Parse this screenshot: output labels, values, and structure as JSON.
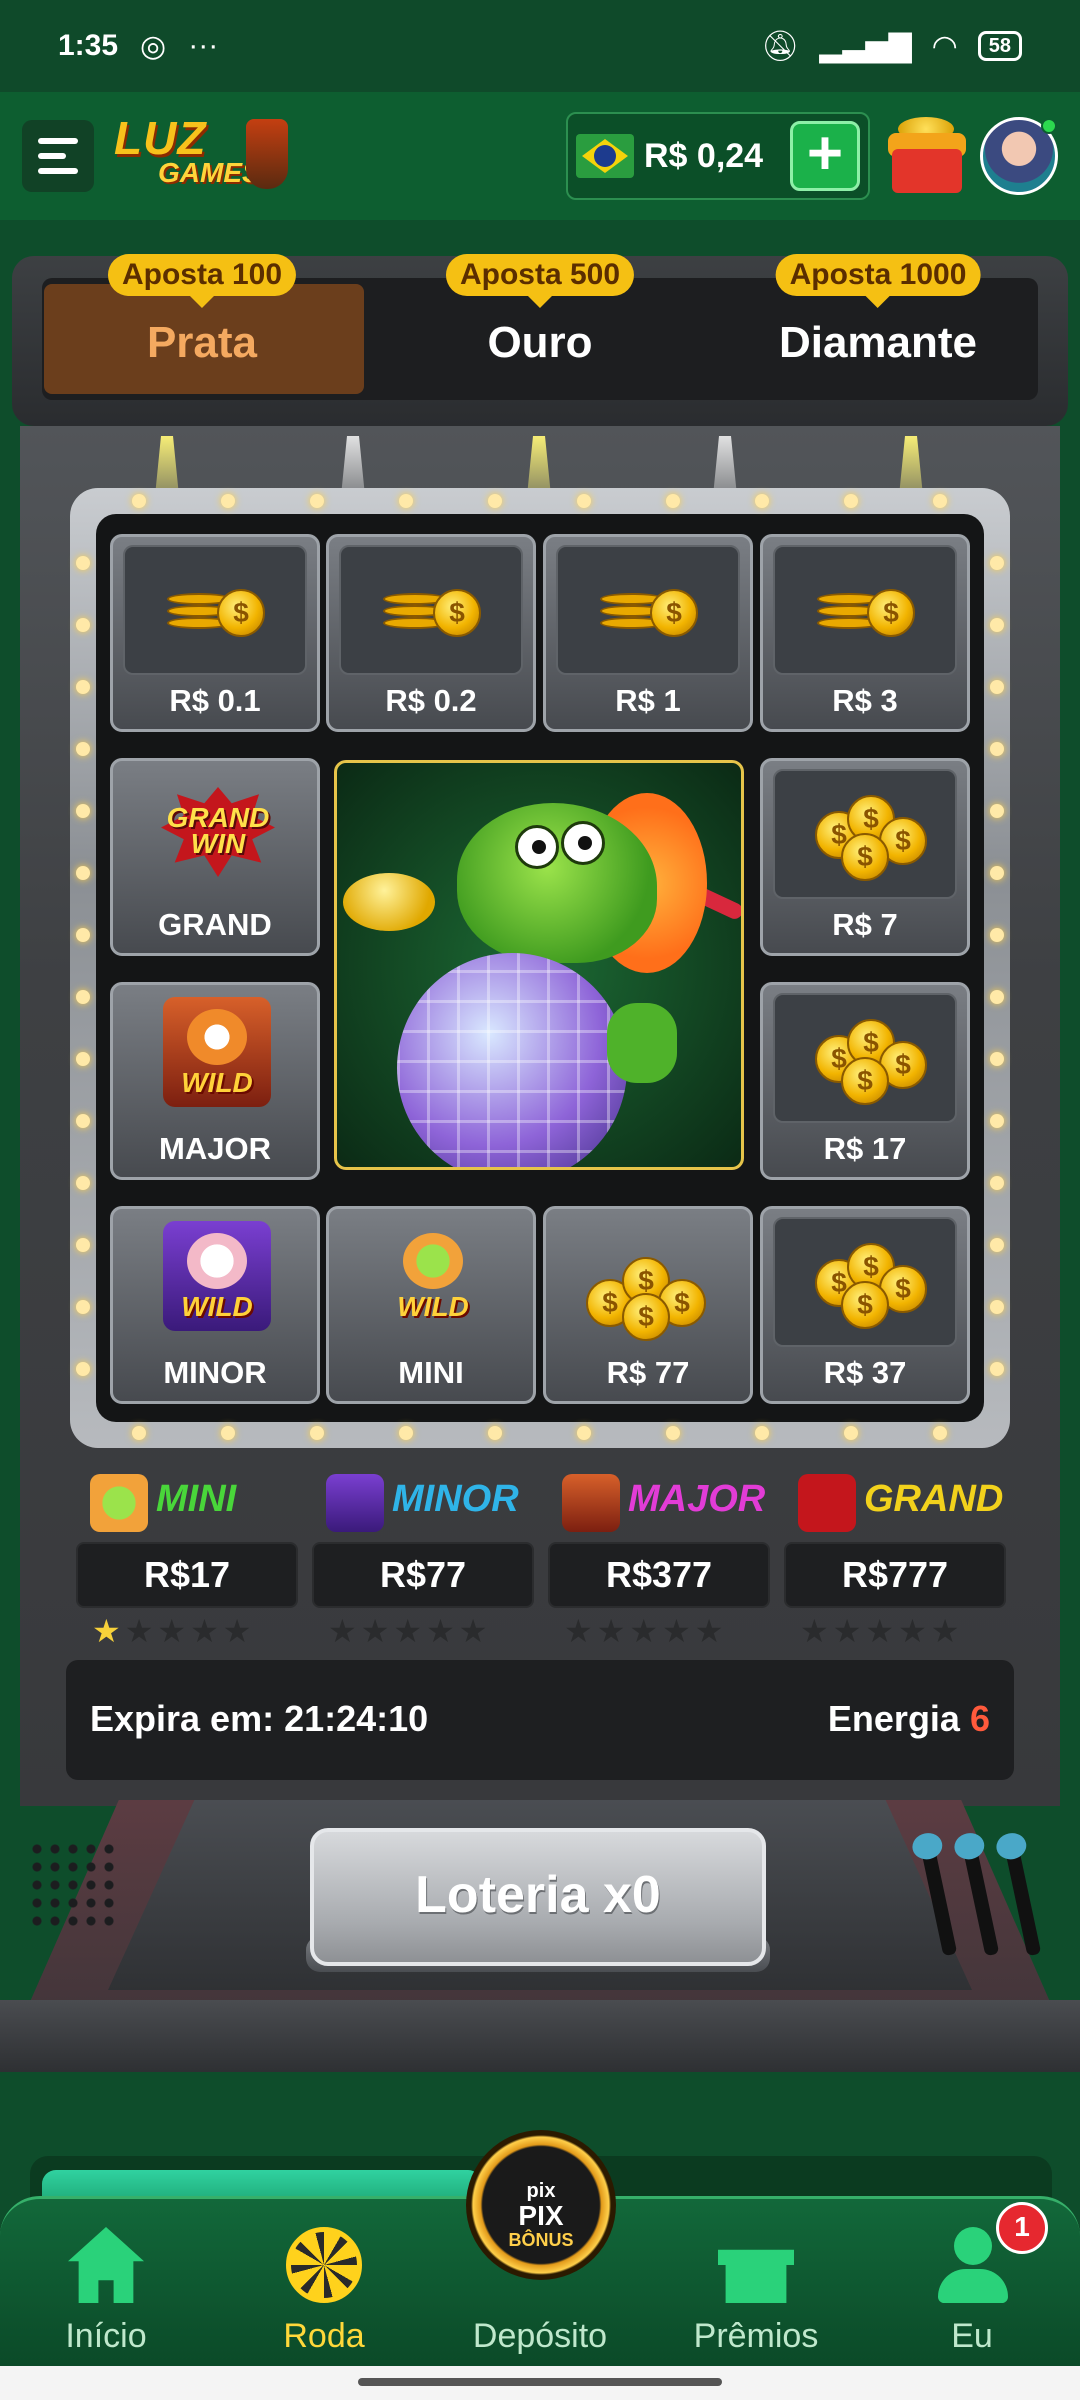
{
  "status_bar": {
    "time": "1:35",
    "battery": "58"
  },
  "header": {
    "logo_text_1": "LUZ",
    "logo_text_2": "GAMES",
    "balance": "R$ 0,24",
    "plus_label": "+"
  },
  "tabs": [
    {
      "badge": "Aposta 100",
      "label": "Prata",
      "active": true
    },
    {
      "badge": "Aposta 500",
      "label": "Ouro",
      "active": false
    },
    {
      "badge": "Aposta 1000",
      "label": "Diamante",
      "active": false
    }
  ],
  "grid": {
    "row1": [
      "R$ 0.1",
      "R$ 0.2",
      "R$ 1",
      "R$ 3"
    ],
    "left": [
      "GRAND",
      "MAJOR"
    ],
    "right": [
      "R$ 7",
      "R$ 17"
    ],
    "row4": [
      "MINOR",
      "MINI",
      "R$ 77",
      "R$ 37"
    ],
    "grand_logo": "GRAND WIN",
    "wild": "WILD"
  },
  "jackpots": [
    {
      "name": "MINI",
      "value": "R$17",
      "stars": 1,
      "color": "#49d63a"
    },
    {
      "name": "MINOR",
      "value": "R$77",
      "stars": 0,
      "color": "#2fb4e8"
    },
    {
      "name": "MAJOR",
      "value": "R$377",
      "stars": 0,
      "color": "#e23cd6"
    },
    {
      "name": "GRAND",
      "value": "R$777",
      "stars": 0,
      "color": "#f2d21c"
    }
  ],
  "info": {
    "expires_label": "Expira em: 21:24:10",
    "energy_label": "Energia",
    "energy_value": "6"
  },
  "lottery_button": "Loteria x0",
  "deposit_badge": {
    "line1": "pix",
    "line2": "PIX",
    "line3": "BÔNUS"
  },
  "nav": [
    {
      "label": "Início",
      "icon": "home-icon",
      "active": false
    },
    {
      "label": "Roda",
      "icon": "wheel-icon",
      "active": true
    },
    {
      "label": "Depósito",
      "icon": "pix-bonus-icon",
      "active": false
    },
    {
      "label": "Prêmios",
      "icon": "gift-icon",
      "active": false
    },
    {
      "label": "Eu",
      "icon": "user-icon",
      "active": false
    }
  ],
  "notification_count": "1",
  "colors": {
    "brand_green": "#0d5e30",
    "accent_gold": "#f5c013",
    "active_tab": "#6b3e1c"
  }
}
